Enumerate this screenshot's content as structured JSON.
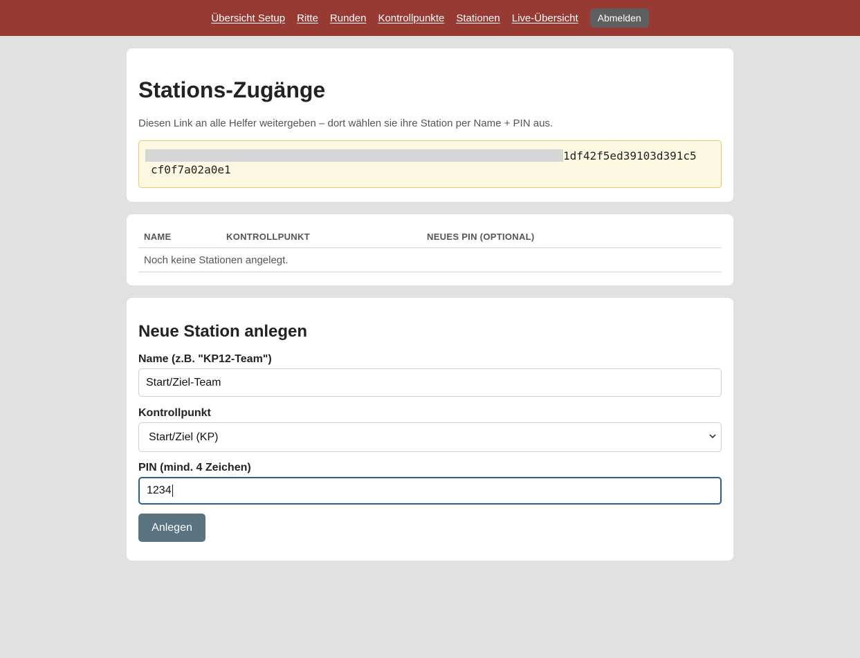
{
  "nav": {
    "links": [
      "Übersicht Setup",
      "Ritte",
      "Runden",
      "Kontrollpunkte",
      "Stationen",
      "Live-Übersicht"
    ],
    "logout_label": "Abmelden",
    "bar_color": "#973a33"
  },
  "access": {
    "title": "Stations-Zugänge",
    "hint": "Diesen Link an alle Helfer weitergeben – dort wählen sie ihre Station per Name + PIN aus.",
    "link_visible_tail_1": "1df42f5ed39103d391c5",
    "link_visible_tail_2": "cf0f7a02a0e1"
  },
  "stations_table": {
    "headers": [
      "NAME",
      "KONTROLLPUNKT",
      "NEUES PIN (OPTIONAL)"
    ],
    "empty_message": "Noch keine Stationen angelegt."
  },
  "new_station": {
    "title": "Neue Station anlegen",
    "name_label": "Name (z.B. \"KP12-Team\")",
    "name_value": "Start/Ziel-Team",
    "checkpoint_label": "Kontrollpunkt",
    "checkpoint_value": "Start/Ziel (KP)",
    "pin_label": "PIN (mind. 4 Zeichen)",
    "pin_value": "1234",
    "submit_label": "Anlegen",
    "submit_color": "#5a7381"
  },
  "icons": {
    "select_arrow": "chevron-down-icon"
  }
}
